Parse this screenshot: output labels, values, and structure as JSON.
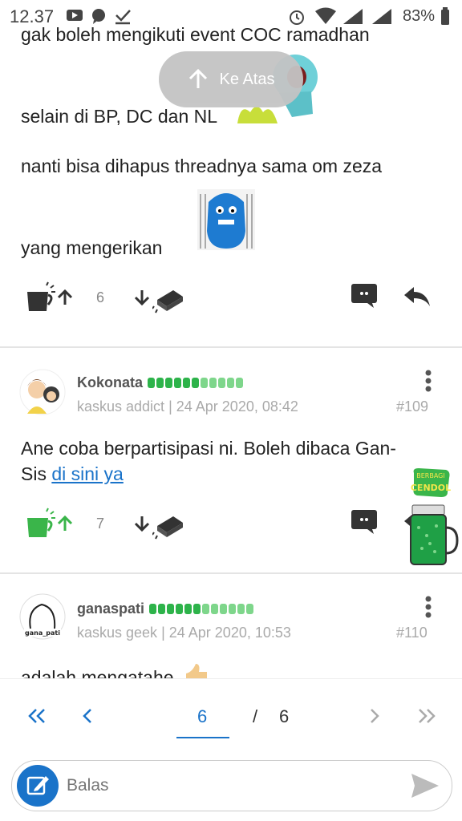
{
  "status_bar": {
    "time": "12.37",
    "battery": "83%"
  },
  "floating": {
    "ke_atas": "Ke Atas"
  },
  "post1": {
    "lines": [
      "gak boleh mengikuti event COC ramadhan",
      "selain di BP, DC dan NL",
      "nanti bisa dihapus threadnya sama om zeza",
      "yang mengerikan"
    ],
    "vote_count": "6"
  },
  "post2": {
    "username": "Kokonata",
    "rank": "kaskus addict",
    "timestamp": "24 Apr 2020, 08:42",
    "number": "#109",
    "text_line1": "Ane coba berpartisipasi ni. Boleh dibaca Gan-",
    "text_line2_prefix": "Sis",
    "link_text": "di sini ya",
    "vote_count": "7",
    "badge_text_1": "BERBAGI",
    "badge_text_2": "CENDOL"
  },
  "post3": {
    "username": "ganaspati",
    "rank": "kaskus geek",
    "timestamp": "24 Apr 2020, 10:53",
    "number": "#110",
    "avatar_text": "gana_pati",
    "partial_text": "adalah mengatahe"
  },
  "pagination": {
    "current_page": "6",
    "separator": "/",
    "total_pages": "6"
  },
  "reply": {
    "placeholder": "Balas"
  },
  "colors": {
    "accent_blue": "#1a73c9",
    "green": "#3ab54a",
    "grey": "#555555"
  }
}
